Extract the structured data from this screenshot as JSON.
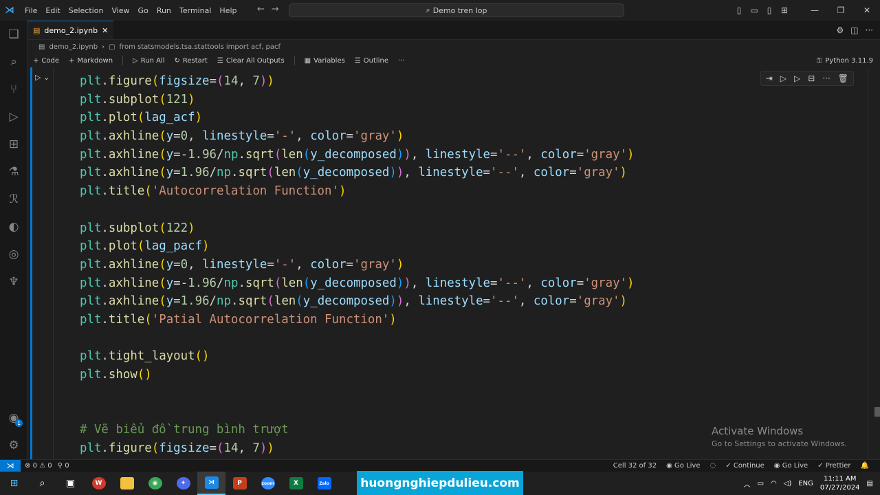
{
  "titlebar": {
    "menu": [
      "File",
      "Edit",
      "Selection",
      "View",
      "Go",
      "Run",
      "Terminal",
      "Help"
    ],
    "search": "Demo tren lop"
  },
  "tab": {
    "label": "demo_2.ipynb"
  },
  "breadcrumb": {
    "file": "demo_2.ipynb",
    "cell": "from statsmodels.tsa.stattools import acf, pacf"
  },
  "toolbar": {
    "code": "Code",
    "markdown": "Markdown",
    "run_all": "Run All",
    "restart": "Restart",
    "clear": "Clear All Outputs",
    "variables": "Variables",
    "outline": "Outline",
    "more": "···",
    "kernel": "Python 3.11.9"
  },
  "code_lines": [
    "plt.figure(figsize=(14, 7))",
    "plt.subplot(121)",
    "plt.plot(lag_acf)",
    "plt.axhline(y=0, linestyle='-', color='gray')",
    "plt.axhline(y=-1.96/np.sqrt(len(y_decomposed)), linestyle='--', color='gray')",
    "plt.axhline(y=1.96/np.sqrt(len(y_decomposed)), linestyle='--', color='gray')",
    "plt.title('Autocorrelation Function')",
    "",
    "plt.subplot(122)",
    "plt.plot(lag_pacf)",
    "plt.axhline(y=0, linestyle='-', color='gray')",
    "plt.axhline(y=-1.96/np.sqrt(len(y_decomposed)), linestyle='--', color='gray')",
    "plt.axhline(y=1.96/np.sqrt(len(y_decomposed)), linestyle='--', color='gray')",
    "plt.title('Patial Autocorrelation Function')",
    "",
    "plt.tight_layout()",
    "plt.show()",
    "",
    "",
    "# Vẽ biểu đồ trung bình trượt",
    "plt.figure(figsize=(14, 7))"
  ],
  "watermark": {
    "title": "Activate Windows",
    "subtitle": "Go to Settings to activate Windows."
  },
  "statusbar": {
    "errors": "0",
    "warnings": "0",
    "ports": "0",
    "cell": "Cell 32 of 32",
    "golive1": "Go Live",
    "continue": "Continue",
    "golive2": "Go Live",
    "prettier": "Prettier"
  },
  "taskbar": {
    "brand": "huongnghiepdulieu.com",
    "lang": "ENG",
    "time": "11:11 AM",
    "date": "07/27/2024"
  },
  "colors": {
    "accent": "#0078d4",
    "brand_bg": "#0aa5d8"
  }
}
